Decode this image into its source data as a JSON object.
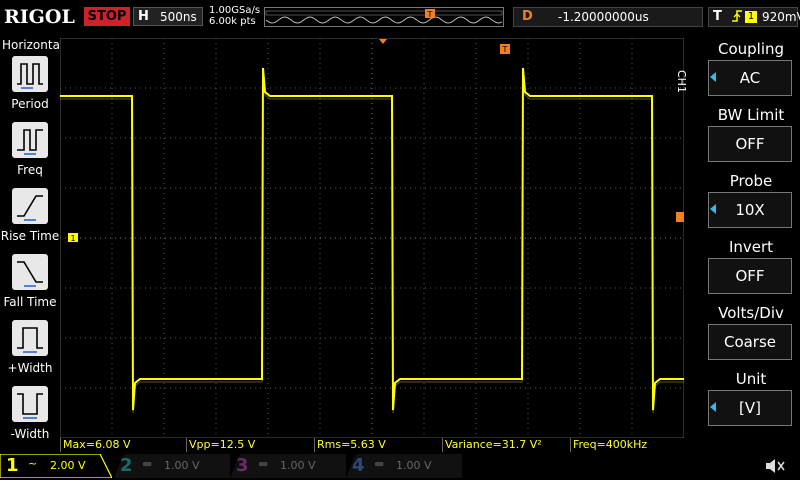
{
  "brand": "RIGOL",
  "run_state": "STOP",
  "timebase": {
    "label": "H",
    "value": "500ns"
  },
  "sampling": {
    "rate": "1.00GSa/s",
    "points": "6.00k pts"
  },
  "delay": {
    "label": "D",
    "value": "-1.20000000us"
  },
  "trigger": {
    "label": "T",
    "channel": "1",
    "level": "920mV"
  },
  "left_panel": {
    "title": "Horizontal",
    "items": [
      {
        "label": "Period",
        "icon": "period-icon"
      },
      {
        "label": "Freq",
        "icon": "freq-icon"
      },
      {
        "label": "Rise Time",
        "icon": "rise-time-icon"
      },
      {
        "label": "Fall Time",
        "icon": "fall-time-icon"
      },
      {
        "label": "+Width",
        "icon": "plus-width-icon"
      },
      {
        "label": "-Width",
        "icon": "minus-width-icon"
      }
    ]
  },
  "right_panel": {
    "channel_tag": "CH1",
    "items": [
      {
        "title": "Coupling",
        "value": "AC",
        "arrow": true
      },
      {
        "title": "BW Limit",
        "value": "OFF",
        "arrow": false
      },
      {
        "title": "Probe",
        "value": "10X",
        "arrow": true
      },
      {
        "title": "Invert",
        "value": "OFF",
        "arrow": false
      },
      {
        "title": "Volts/Div",
        "value": "Coarse",
        "arrow": false
      },
      {
        "title": "Unit",
        "value": "[V]",
        "arrow": true
      }
    ]
  },
  "measurements": [
    {
      "text": "Max=6.08 V"
    },
    {
      "text": "Vpp=12.5 V"
    },
    {
      "text": "Rms=5.63 V"
    },
    {
      "text": "Variance=31.7 V²"
    },
    {
      "text": "Freq=400kHz"
    }
  ],
  "channels": [
    {
      "num": "1",
      "coupling": "~",
      "scale": "2.00 V",
      "color": "#ffff00",
      "active": true
    },
    {
      "num": "2",
      "coupling": "",
      "scale": "1.00 V",
      "color": "#00c8c8",
      "active": false
    },
    {
      "num": "3",
      "coupling": "",
      "scale": "1.00 V",
      "color": "#d040d0",
      "active": false
    },
    {
      "num": "4",
      "coupling": "",
      "scale": "1.00 V",
      "color": "#3090ff",
      "active": false
    }
  ],
  "colors": {
    "trace": "#ffff00",
    "marker": "#f08020",
    "accent": "#38b8e8",
    "stop": "#d0202a"
  }
}
